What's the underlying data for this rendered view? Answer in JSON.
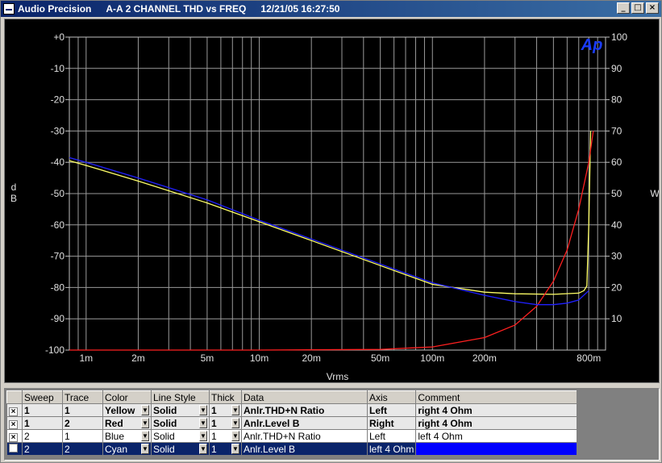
{
  "window": {
    "app": "Audio Precision",
    "test": "A-A 2 CHANNEL  THD vs FREQ",
    "timestamp": "12/21/05 16:27:50",
    "minimize": "_",
    "maximize": "□",
    "close": "×"
  },
  "chart_data": {
    "type": "line",
    "title": "",
    "xlabel": "Vrms",
    "ylabel": "dB",
    "y2label": "W",
    "x_scale": "log",
    "xlim": [
      0.0008,
      1.0
    ],
    "ylim": [
      -100,
      0
    ],
    "y2lim": [
      0,
      100
    ],
    "x_ticks": [
      "1m",
      "2m",
      "5m",
      "10m",
      "20m",
      "50m",
      "100m",
      "200m",
      "800m"
    ],
    "x_tick_values": [
      0.001,
      0.002,
      0.005,
      0.01,
      0.02,
      0.05,
      0.1,
      0.2,
      0.8
    ],
    "y_ticks": [
      "+0",
      "-10",
      "-20",
      "-30",
      "-40",
      "-50",
      "-60",
      "-70",
      "-80",
      "-90",
      "-100"
    ],
    "y_tick_values": [
      0,
      -10,
      -20,
      -30,
      -40,
      -50,
      -60,
      -70,
      -80,
      -90,
      -100
    ],
    "y2_ticks": [
      "100",
      "90",
      "80",
      "70",
      "60",
      "50",
      "40",
      "30",
      "20",
      "10"
    ],
    "y2_tick_values": [
      100,
      90,
      80,
      70,
      60,
      50,
      40,
      30,
      20,
      10
    ],
    "grid": true,
    "logo": "Ap",
    "series": [
      {
        "name": "Anlr.THD+N Ratio",
        "axis": "left",
        "color": "#ffff66",
        "x": [
          0.0008,
          0.001,
          0.002,
          0.005,
          0.01,
          0.02,
          0.05,
          0.1,
          0.2,
          0.3,
          0.5,
          0.7,
          0.75,
          0.78,
          0.8,
          0.82
        ],
        "y": [
          -39.5,
          -41,
          -46,
          -53,
          -59,
          -65,
          -73,
          -79,
          -81.5,
          -82,
          -82.2,
          -81.8,
          -81,
          -79.5,
          -60,
          -30
        ]
      },
      {
        "name": "Anlr.Level B",
        "axis": "right",
        "color": "#ff2020",
        "x": [
          0.0008,
          0.01,
          0.05,
          0.1,
          0.2,
          0.3,
          0.4,
          0.5,
          0.6,
          0.7,
          0.8,
          0.85
        ],
        "y": [
          0,
          0,
          0.2,
          1,
          4,
          8,
          14,
          22,
          32,
          45,
          60,
          70
        ]
      },
      {
        "name": "Anlr.THD+N Ratio",
        "axis": "left",
        "color": "#2020ff",
        "x": [
          0.0008,
          0.001,
          0.002,
          0.005,
          0.01,
          0.02,
          0.05,
          0.1,
          0.2,
          0.3,
          0.4,
          0.5,
          0.6,
          0.7,
          0.8
        ],
        "y": [
          -38.5,
          -40,
          -45,
          -52,
          -58.5,
          -64.5,
          -72.5,
          -78.5,
          -82.5,
          -84.5,
          -85.5,
          -85.5,
          -85,
          -84,
          -81
        ]
      }
    ]
  },
  "table": {
    "headers": [
      "",
      "Sweep",
      "Trace",
      "Color",
      "Line Style",
      "Thick",
      "Data",
      "Axis",
      "Comment"
    ],
    "rows": [
      {
        "check": "×",
        "sweep": "1",
        "trace": "1",
        "color": "Yellow",
        "style": "Solid",
        "thick": "1",
        "data": "Anlr.THD+N Ratio",
        "axis": "Left",
        "comment": "right 4 Ohm"
      },
      {
        "check": "×",
        "sweep": "1",
        "trace": "2",
        "color": "Red",
        "style": "Solid",
        "thick": "1",
        "data": "Anlr.Level B",
        "axis": "Right",
        "comment": "right 4 Ohm"
      },
      {
        "check": "×",
        "sweep": "2",
        "trace": "1",
        "color": "Blue",
        "style": "Solid",
        "thick": "1",
        "data": "Anlr.THD+N Ratio",
        "axis": "Left",
        "comment": "left 4 Ohm"
      },
      {
        "check": "",
        "sweep": "2",
        "trace": "2",
        "color": "Cyan",
        "style": "Solid",
        "thick": "1",
        "data": "Anlr.Level B",
        "axis": "left 4 Ohm",
        "comment": ""
      }
    ]
  }
}
